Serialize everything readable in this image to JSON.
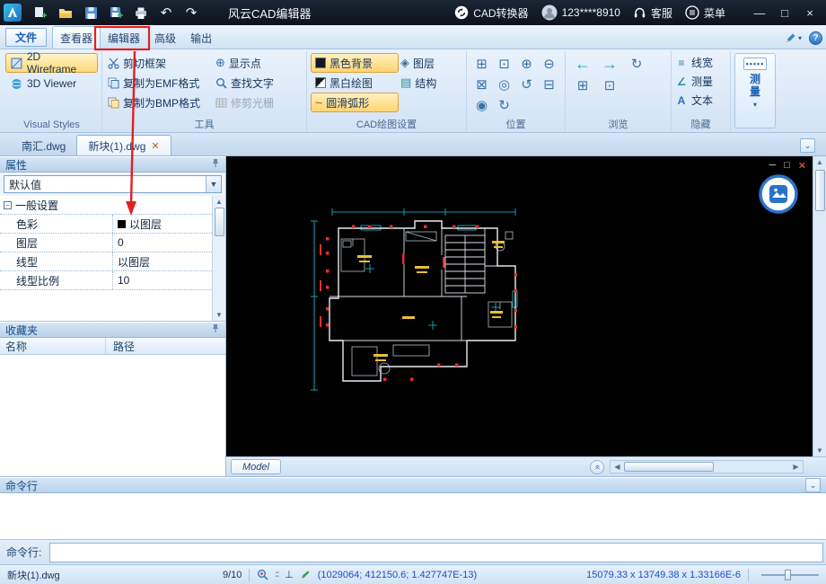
{
  "titlebar": {
    "title": "风云CAD编辑器",
    "converter_label": "CAD转换器",
    "account_label": "123****8910",
    "service_label": "客服",
    "menu_label": "菜单"
  },
  "ribbon_tabs": [
    {
      "label": "文件"
    },
    {
      "label": "查看器"
    },
    {
      "label": "编辑器"
    },
    {
      "label": "高级"
    },
    {
      "label": "输出"
    }
  ],
  "ribbon": {
    "visual_styles": {
      "label": "Visual Styles",
      "items": [
        {
          "label": "2D Wireframe"
        },
        {
          "label": "3D Viewer"
        }
      ]
    },
    "tools": {
      "label": "工具",
      "items": [
        {
          "label": "剪切框架"
        },
        {
          "label": "复制为EMF格式"
        },
        {
          "label": "复制为BMP格式"
        },
        {
          "label": "显示点"
        },
        {
          "label": "查找文字"
        },
        {
          "label": "修剪光栅"
        }
      ]
    },
    "cad_settings": {
      "label": "CAD绘图设置",
      "toggles": [
        {
          "label": "黑色背景",
          "on": true
        },
        {
          "label": "黑白绘图",
          "on": false
        },
        {
          "label": "圆滑弧形",
          "on": true
        }
      ],
      "items": [
        {
          "label": "图层"
        },
        {
          "label": "结构"
        }
      ]
    },
    "position": {
      "label": "位置"
    },
    "browse": {
      "label": "浏览"
    },
    "hide": {
      "label": "隐藏",
      "items": [
        {
          "label": "线宽"
        },
        {
          "label": "测量"
        },
        {
          "label": "文本"
        }
      ]
    },
    "measure": {
      "label": "测量"
    }
  },
  "doc_tabs": [
    {
      "label": "南汇.dwg"
    },
    {
      "label": "新块(1).dwg"
    }
  ],
  "properties": {
    "title": "属性",
    "preset": "默认值",
    "group_header": "一般设置",
    "rows": [
      {
        "name": "色彩",
        "value": "以图层"
      },
      {
        "name": "图层",
        "value": "0"
      },
      {
        "name": "线型",
        "value": "以图层"
      },
      {
        "name": "线型比例",
        "value": "10"
      }
    ]
  },
  "favorites": {
    "title": "收藏夹",
    "col_name": "名称",
    "col_path": "路径"
  },
  "drawing": {
    "model_tab": "Model"
  },
  "command": {
    "panel_title": "命令行",
    "prompt": "命令行:",
    "input_value": ""
  },
  "statusbar": {
    "file": "新块(1).dwg",
    "counter": "9/10",
    "coordinates": "(1029064; 412150.6; 1.427747E-13)",
    "dimensions": "15079.33 x 13749.38 x 1.33166E-6"
  },
  "colors": {
    "highlight": "#ffd978",
    "accent_blue": "#2a72c8",
    "annotation_red": "#e02020"
  }
}
